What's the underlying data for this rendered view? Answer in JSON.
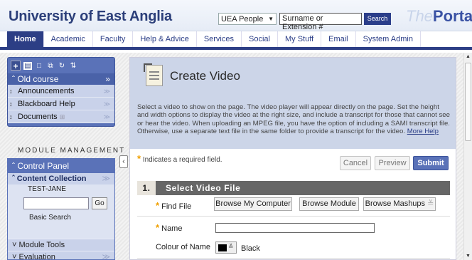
{
  "header": {
    "title": "University of East Anglia",
    "people_select": "UEA People",
    "search_placeholder": "Surname or Extension #",
    "search_button": "Search",
    "portal_the": "The",
    "portal_name": "Portal"
  },
  "nav": {
    "tabs": [
      "Home",
      "Academic",
      "Faculty",
      "Help & Advice",
      "Services",
      "Social",
      "My Stuff",
      "Email",
      "System Admin"
    ]
  },
  "course_menu": {
    "title": "Old course",
    "items": [
      "Announcements",
      "Blackboard Help",
      "Documents"
    ]
  },
  "module_management": {
    "title": "MODULE MANAGEMENT",
    "control_panel": "Control Panel",
    "content_collection": "Content Collection",
    "user": "TEST-JANE",
    "go": "Go",
    "basic_search": "Basic Search",
    "module_tools": "Module Tools",
    "evaluation": "Evaluation"
  },
  "main": {
    "title": "Create Video",
    "intro": "Select a video to show on the page. The video player will appear directly on the page. Set the height and width options to display the video at the right size, and include a transcript for those that cannot see or hear the video. When uploading an MPEG file, you have the option of including a SAMI transcript file. Otherwise, use a separate text file in the same folder to provide a transcript for the video.",
    "more_help": "More Help",
    "required_note": "Indicates a required field.",
    "cancel": "Cancel",
    "preview": "Preview",
    "submit": "Submit",
    "section_number": "1.",
    "section_title": "Select Video File",
    "find_file_label": "Find File",
    "browse_computer": "Browse My Computer",
    "browse_module": "Browse Module",
    "browse_mashups": "Browse Mashups",
    "name_label": "Name",
    "name_value": "",
    "colour_label": "Colour of Name",
    "colour_value": "Black"
  },
  "colors": {
    "brand": "#2c3e85",
    "menu": "#5a72b8",
    "required_star": "#f0a000"
  }
}
